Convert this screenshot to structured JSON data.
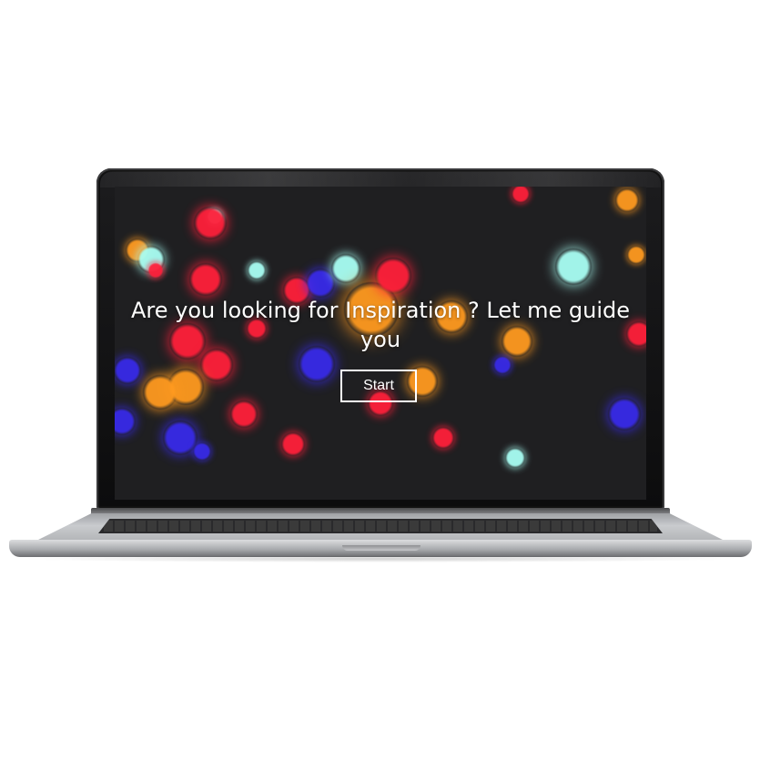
{
  "hero": {
    "headline": "Are you looking for Inspiration ? Let me guide you",
    "start_label": "Start"
  },
  "colors": {
    "screen_background": "#1f1f21",
    "red": "#ff1f3a",
    "orange": "#ff9a1f",
    "blue": "#3b2bff",
    "cyan": "#a9fff4",
    "text": "#ffffff"
  }
}
